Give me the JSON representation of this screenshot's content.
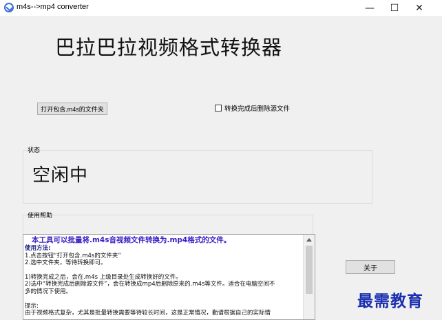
{
  "window": {
    "title": "m4s-->mp4 converter",
    "icon": "app-logo-icon",
    "controls": {
      "minimize": "—",
      "maximize": "☐",
      "close": "✕"
    }
  },
  "heading": "巴拉巴拉视频格式转换器",
  "open_button": {
    "label": "打开包含.m4s的文件夹"
  },
  "delete_checkbox": {
    "label": "转换完成后删除源文件",
    "checked": false
  },
  "status": {
    "label": "状态",
    "value": "空闲中"
  },
  "help": {
    "label": "使用帮助",
    "heading": "本工具可以批量将.m4s音视频文件转换为.mp4格式的文件。",
    "usage_title": "使用方法:",
    "lines": [
      "1.点击按钮“打开包含.m4s的文件夹”",
      "2.选中文件夹，等待转换即可。",
      "",
      "1)转换完成之后，会在.m4s 上级目录处生成转换好的文件。",
      "2)选中“转换完成后删除源文件”，会在转换成mp4后删除原来的.m4s等文件。适合在电脑空间不",
      "多的情况下使用。",
      "",
      "提示:",
      "由于视频格式复杂，尤其是批量转换需要等待较长时间，这是正常情况，勤请根据自己的实际情"
    ]
  },
  "about_button": {
    "label": "关于"
  },
  "watermark": "最需教育",
  "colors": {
    "help_heading": "#3a20c8",
    "watermark": "#1a2fb0",
    "app_icon": "#3a6fd8"
  }
}
